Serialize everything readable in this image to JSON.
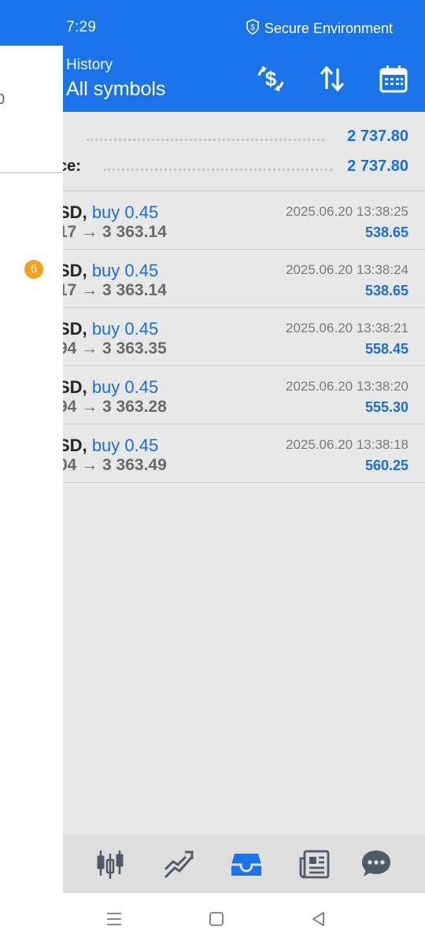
{
  "status_bar": {
    "time": "7:29",
    "secure_label": "Secure Environment",
    "secure_icon": "shield-dollar-icon"
  },
  "drawer": {
    "partial_text": "0",
    "badge": "6"
  },
  "header": {
    "subtitle": "History",
    "title": "All symbols",
    "actions": [
      {
        "name": "currency-exchange-icon"
      },
      {
        "name": "sort-icon"
      },
      {
        "name": "calendar-icon"
      }
    ]
  },
  "summary": {
    "rows": [
      {
        "label": "",
        "value": "2 737.80"
      },
      {
        "label": "ce:",
        "value": "2 737.80"
      }
    ]
  },
  "deals": [
    {
      "symbol": "SD,",
      "type": "buy 0.45",
      "open": "17",
      "close": "3 363.14",
      "time": "2025.06.20 13:38:25",
      "profit": "538.65"
    },
    {
      "symbol": "SD,",
      "type": "buy 0.45",
      "open": "17",
      "close": "3 363.14",
      "time": "2025.06.20 13:38:24",
      "profit": "538.65"
    },
    {
      "symbol": "SD,",
      "type": "buy 0.45",
      "open": "94",
      "close": "3 363.35",
      "time": "2025.06.20 13:38:21",
      "profit": "558.45"
    },
    {
      "symbol": "SD,",
      "type": "buy 0.45",
      "open": "94",
      "close": "3 363.28",
      "time": "2025.06.20 13:38:20",
      "profit": "555.30"
    },
    {
      "symbol": "SD,",
      "type": "buy 0.45",
      "open": "04",
      "close": "3 363.49",
      "time": "2025.06.20 13:38:18",
      "profit": "560.25"
    }
  ],
  "arrow": "→",
  "bottom_nav": [
    {
      "name": "quotes-candles-icon",
      "active": false
    },
    {
      "name": "trade-chart-icon",
      "active": false
    },
    {
      "name": "history-inbox-icon",
      "active": true
    },
    {
      "name": "news-icon",
      "active": false
    },
    {
      "name": "chat-icon",
      "active": false
    }
  ],
  "colors": {
    "accent": "#1a73e8",
    "profit": "#1a6fd6",
    "badge": "#f4a21b",
    "panel": "#e8e8e8"
  }
}
